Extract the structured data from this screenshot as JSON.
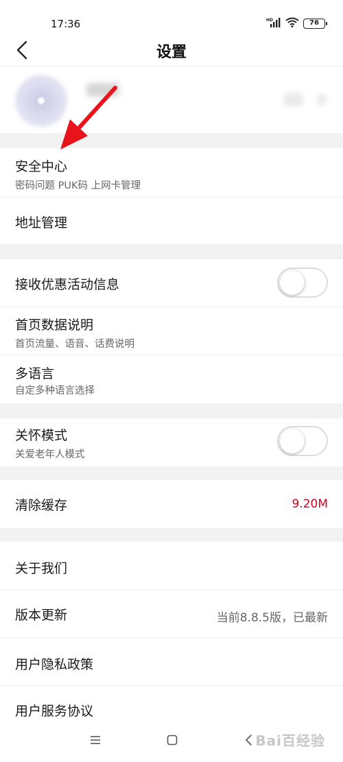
{
  "status_bar": {
    "time": "17:36",
    "battery": "76",
    "signal_label": "HD"
  },
  "nav": {
    "title": "设置",
    "back_icon": "chevron-left-icon"
  },
  "sections": {
    "security": {
      "title": "安全中心",
      "subtitle": "密码问题 PUK码 上网卡管理"
    },
    "address": {
      "title": "地址管理"
    },
    "promo": {
      "title": "接收优惠活动信息",
      "toggle_on": false
    },
    "home_data": {
      "title": "首页数据说明",
      "subtitle": "首页流量、语音、话费说明"
    },
    "language": {
      "title": "多语言",
      "subtitle": "自定多种语言选择"
    },
    "care_mode": {
      "title": "关怀模式",
      "subtitle": "关爱老年人模式",
      "toggle_on": false
    },
    "cache": {
      "title": "清除缓存",
      "value": "9.20M"
    },
    "about": {
      "title": "关于我们"
    },
    "version": {
      "title": "版本更新",
      "value": "当前8.8.5版，已最新"
    },
    "privacy": {
      "title": "用户隐私政策"
    },
    "service": {
      "title": "用户服务协议"
    }
  },
  "colors": {
    "accent_red": "#d0021b",
    "gap_gray": "#f2f2f2",
    "annotation_red": "#e8131b"
  },
  "watermark": "Bai百经验"
}
